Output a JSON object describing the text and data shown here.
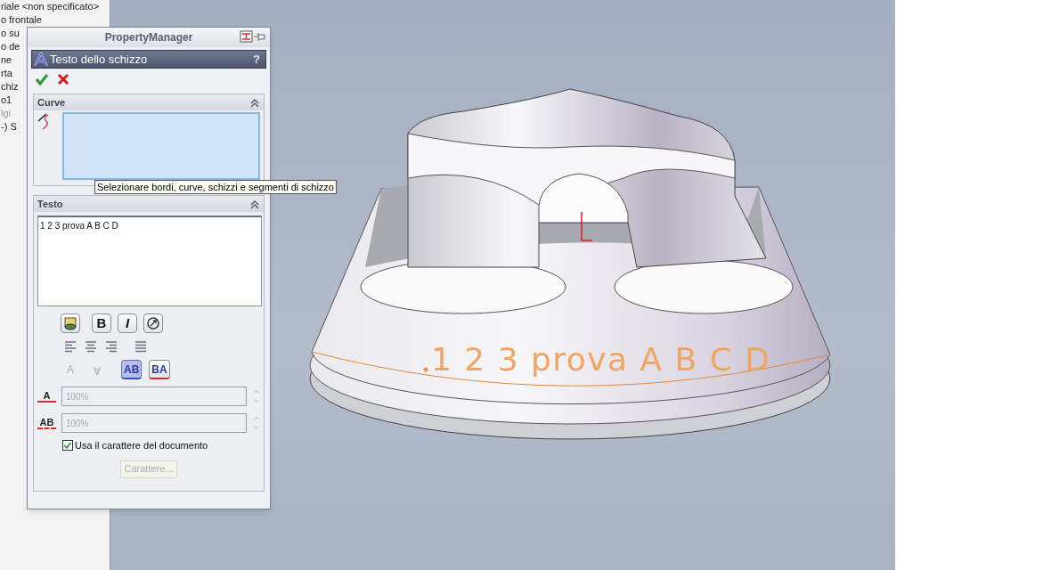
{
  "feature_tree": {
    "items": [
      {
        "label": "riale <non specificato>",
        "disabled": false
      },
      {
        "label": "o frontale",
        "disabled": false
      },
      {
        "label": "o su",
        "disabled": false
      },
      {
        "label": "o de",
        "disabled": false
      },
      {
        "label": "ne",
        "disabled": false
      },
      {
        "label": "rta",
        "disabled": false
      },
      {
        "label": "chiz",
        "disabled": false
      },
      {
        "label": "o1",
        "disabled": false
      },
      {
        "label": "lgi",
        "disabled": true
      },
      {
        "label": "-) S",
        "disabled": false
      }
    ]
  },
  "property_manager": {
    "title": "PropertyManager",
    "panel_title": "Testo dello schizzo",
    "help": "?",
    "curves_section": {
      "title": "Curve",
      "expanded": true,
      "tooltip": "Selezionare bordi, curve, schizzi e segmenti di schizzo"
    },
    "text_section": {
      "title": "Testo",
      "expanded": true,
      "text_value": "1 2 3 prova A B C D",
      "style_buttons": [
        {
          "kind": "link"
        },
        {
          "kind": "bold",
          "label": "B"
        },
        {
          "kind": "italic",
          "label": "I"
        },
        {
          "kind": "rotate"
        }
      ],
      "align_buttons": [
        {
          "kind": "left"
        },
        {
          "kind": "center"
        },
        {
          "kind": "right"
        },
        {
          "kind": "justify"
        }
      ],
      "direction_buttons": [
        {
          "kind": "plain",
          "label": "A",
          "disabled": true,
          "selected": false
        },
        {
          "kind": "flipped",
          "label": "∀",
          "disabled": true,
          "selected": false
        },
        {
          "kind": "ltr",
          "label": "AB",
          "disabled": false,
          "selected": true
        },
        {
          "kind": "rtl",
          "label": "BA",
          "disabled": false,
          "selected": false
        }
      ],
      "fields": [
        {
          "kind": "width",
          "icon_label": "A",
          "value": "100%",
          "disabled": true
        },
        {
          "kind": "spacing",
          "icon_label": "AB",
          "value": "100%",
          "disabled": true
        }
      ],
      "use_document_font": {
        "label": "Usa il carattere del documento",
        "checked": true
      },
      "font_button": {
        "label": "Carattere...",
        "disabled": true
      }
    }
  },
  "model": {
    "engraved_text": "1 2 3 prova A B C D"
  }
}
